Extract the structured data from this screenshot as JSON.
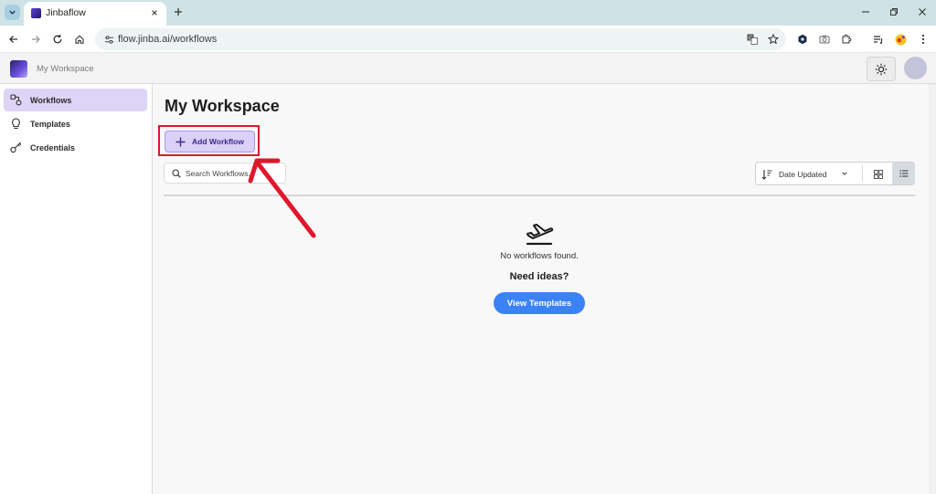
{
  "browser": {
    "tab_title": "Jinbaflow",
    "url": "flow.jinba.ai/workflows"
  },
  "icons": {
    "tab_menu": "chevron-down-icon",
    "tab_close": "close-icon",
    "new_tab": "plus-icon",
    "back": "arrow-left-icon",
    "forward": "arrow-right-icon",
    "reload": "reload-icon",
    "home": "home-icon",
    "site_info": "tune-icon",
    "translate": "translate-icon",
    "bookmark": "star-icon",
    "theme": "sun-icon",
    "add": "plus-icon",
    "search": "search-icon",
    "sort": "sort-icon",
    "chevron": "chevron-down-icon",
    "grid_view": "grid-icon",
    "list_view": "list-icon",
    "empty_state": "plane-takeoff-icon"
  },
  "app": {
    "workspace_label": "My Workspace"
  },
  "sidebar": {
    "items": [
      {
        "label": "Workflows",
        "icon": "workflow-icon",
        "active": true
      },
      {
        "label": "Templates",
        "icon": "lightbulb-icon",
        "active": false
      },
      {
        "label": "Credentials",
        "icon": "key-icon",
        "active": false
      }
    ]
  },
  "main": {
    "title": "My Workspace",
    "add_button_label": "Add Workflow",
    "search_placeholder": "Search Workflows...",
    "sort_label": "Date Updated",
    "empty_message": "No workflows found.",
    "ideas_heading": "Need ideas?",
    "view_templates_label": "View Templates"
  },
  "colors": {
    "accent": "#3b82f6",
    "sidebar_active": "#ddd4f7",
    "add_button_bg": "#d9d1f6",
    "highlight_box": "#e0162b"
  }
}
